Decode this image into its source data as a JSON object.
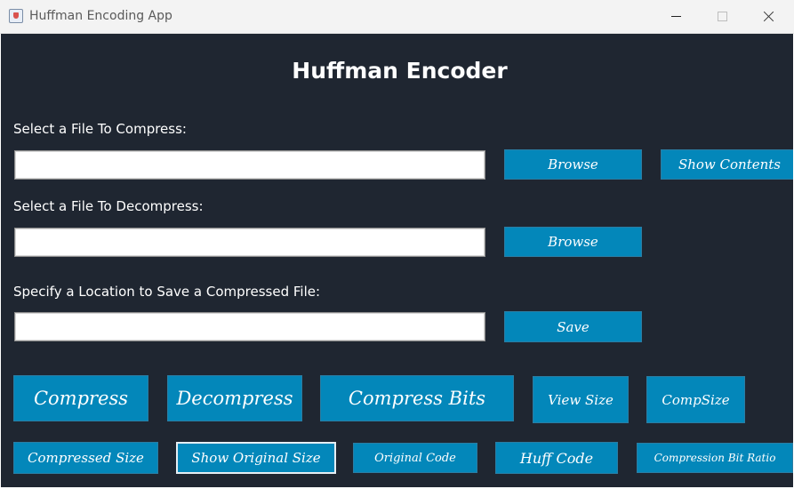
{
  "window": {
    "title": "Huffman Encoding App"
  },
  "heading": "Huffman Encoder",
  "compress_section": {
    "label": "Select a File To Compress:",
    "value": "",
    "browse_label": "Browse",
    "show_contents_label": "Show Contents"
  },
  "decompress_section": {
    "label": "Select a File To Decompress:",
    "value": "",
    "browse_label": "Browse"
  },
  "save_section": {
    "label": "Specify a Location to Save a Compressed File:",
    "value": "",
    "save_label": "Save"
  },
  "actions": {
    "compress": "Compress",
    "decompress": "Decompress",
    "compress_bits": "Compress Bits",
    "view_size": "View Size",
    "comp_size": "CompSize"
  },
  "info": {
    "compressed_size": "Compressed Size",
    "show_original_size": "Show Original Size",
    "original_code": "Original Code",
    "huff_code": "Huff Code",
    "compression_bit_ratio": "Compression Bit Ratio"
  },
  "colors": {
    "background": "#1f2631",
    "button": "#0387ba",
    "text": "#ffffff"
  }
}
